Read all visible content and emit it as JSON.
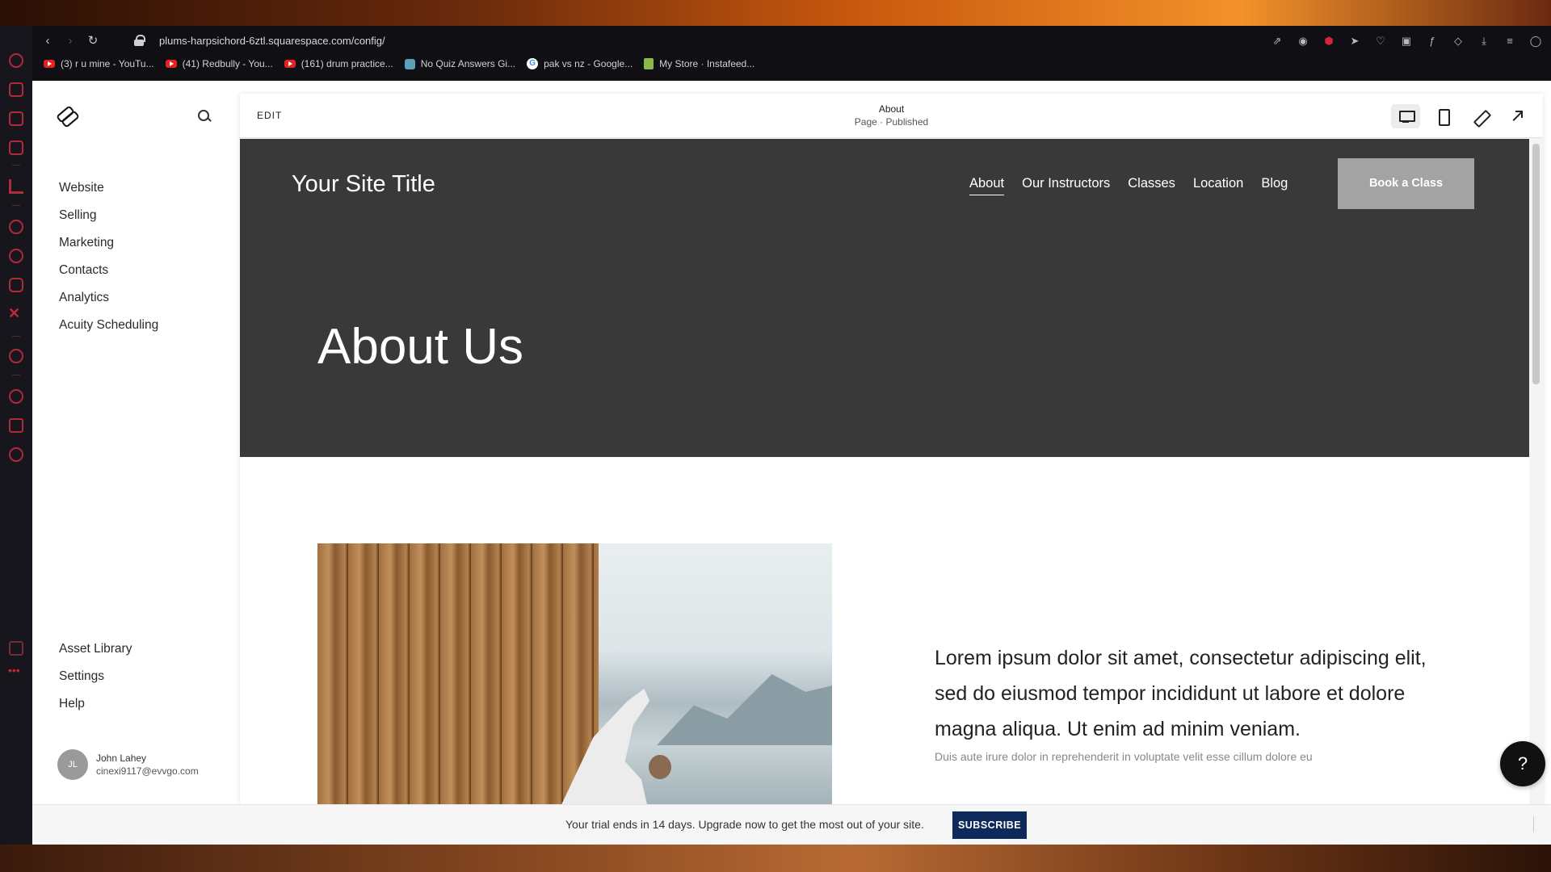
{
  "browser": {
    "url": "plums-harpsichord-6ztl.squarespace.com/config/",
    "bookmarks": [
      {
        "label": "(3) r u mine - YouTu...",
        "icon": "youtube-icon"
      },
      {
        "label": "(41) Redbully - You...",
        "icon": "youtube-icon"
      },
      {
        "label": "(161) drum practice...",
        "icon": "youtube-icon"
      },
      {
        "label": "No Quiz Answers Gi...",
        "icon": "quiz-icon"
      },
      {
        "label": "pak vs nz - Google...",
        "icon": "google-icon"
      },
      {
        "label": "My Store · Instafeed...",
        "icon": "shopify-icon"
      }
    ]
  },
  "sidebar": {
    "main": [
      "Website",
      "Selling",
      "Marketing",
      "Contacts",
      "Analytics",
      "Acuity Scheduling"
    ],
    "bottom": [
      "Asset Library",
      "Settings",
      "Help"
    ],
    "user": {
      "initials": "JL",
      "name": "John Lahey",
      "email": "cinexi9117@evvgo.com"
    }
  },
  "editor": {
    "edit_label": "EDIT",
    "page_title": "About",
    "page_status": "Page · Published"
  },
  "site": {
    "title": "Your Site Title",
    "nav": [
      "About",
      "Our Instructors",
      "Classes",
      "Location",
      "Blog"
    ],
    "current_nav": "About",
    "cta": "Book a Class",
    "heading": "About Us",
    "body": "Lorem ipsum dolor sit amet, consectetur adipiscing elit, sed do eiusmod tempor incididunt ut labore et dolore magna aliqua. Ut enim ad minim veniam.",
    "body_cut": "Duis aute irure dolor in reprehenderit in voluptate velit esse cillum dolore eu"
  },
  "help_label": "?",
  "trial": {
    "text": "Your trial ends in 14 days. Upgrade now to get the most out of your site.",
    "button": "SUBSCRIBE"
  }
}
